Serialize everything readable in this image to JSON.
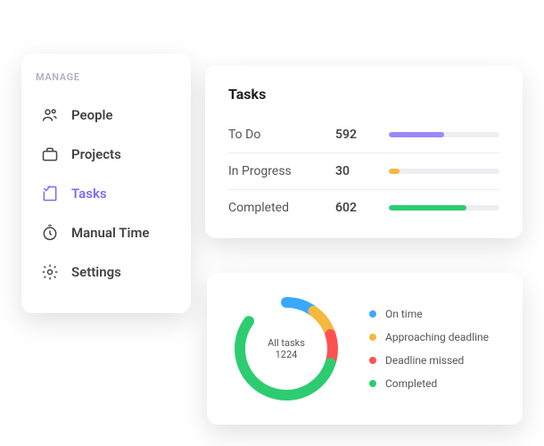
{
  "sidebar": {
    "title": "MANAGE",
    "items": [
      {
        "label": "People",
        "icon": "people-icon",
        "active": false
      },
      {
        "label": "Projects",
        "icon": "briefcase-icon",
        "active": false
      },
      {
        "label": "Tasks",
        "icon": "checklist-icon",
        "active": true
      },
      {
        "label": "Manual Time",
        "icon": "timer-icon",
        "active": false
      },
      {
        "label": "Settings",
        "icon": "gear-icon",
        "active": false
      }
    ]
  },
  "tasks": {
    "title": "Tasks",
    "rows": [
      {
        "label": "To Do",
        "count": "592",
        "percent": 50,
        "color": "#9a8af7"
      },
      {
        "label": "In Progress",
        "count": "30",
        "percent": 10,
        "color": "#f4b93e"
      },
      {
        "label": "Completed",
        "count": "602",
        "percent": 70,
        "color": "#2ecc71"
      }
    ]
  },
  "summary": {
    "center_label": "All tasks 1224",
    "legend": [
      {
        "label": "On time",
        "color": "#3aa8ff"
      },
      {
        "label": "Approaching deadline",
        "color": "#f4b93e"
      },
      {
        "label": "Deadline missed",
        "color": "#ff5151"
      },
      {
        "label": "Completed",
        "color": "#2ecc71"
      }
    ]
  },
  "chart_data": {
    "type": "pie",
    "title": "All tasks 1224",
    "total": 1224,
    "series": [
      {
        "name": "On time",
        "percent": 10,
        "color": "#3aa8ff"
      },
      {
        "name": "Approaching deadline",
        "percent": 10,
        "color": "#f4b93e"
      },
      {
        "name": "Deadline missed",
        "percent": 10,
        "color": "#ff5151"
      },
      {
        "name": "Completed",
        "percent": 55,
        "color": "#2ecc71"
      }
    ],
    "gap_percent": 15
  }
}
